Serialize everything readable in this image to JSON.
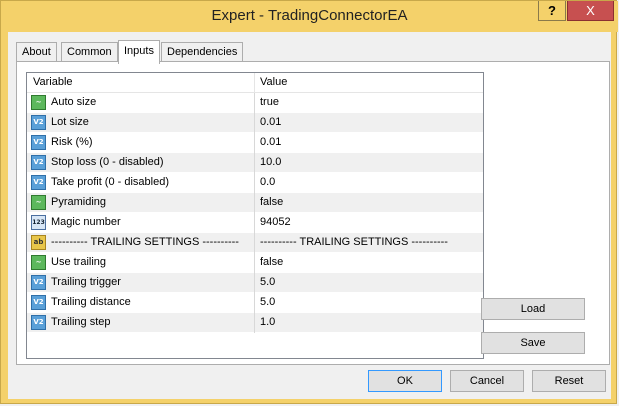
{
  "window": {
    "title": "Expert - TradingConnectorEA",
    "help_label": "?",
    "close_label": "X"
  },
  "tabs": [
    "About",
    "Common",
    "Inputs",
    "Dependencies"
  ],
  "active_tab": "Inputs",
  "grid": {
    "col_variable": "Variable",
    "col_value": "Value",
    "rows": [
      {
        "icon": "bool-icon",
        "name": "Auto size",
        "value": "true"
      },
      {
        "icon": "double-icon",
        "name": "Lot size",
        "value": "0.01"
      },
      {
        "icon": "double-icon",
        "name": "Risk (%)",
        "value": "0.01"
      },
      {
        "icon": "double-icon",
        "name": "Stop loss (0 - disabled)",
        "value": "10.0"
      },
      {
        "icon": "double-icon",
        "name": "Take profit (0 - disabled)",
        "value": "0.0"
      },
      {
        "icon": "bool-icon",
        "name": "Pyramiding",
        "value": "false"
      },
      {
        "icon": "int-icon",
        "name": "Magic number",
        "value": "94052"
      },
      {
        "icon": "string-icon",
        "name": "---------- TRAILING SETTINGS ----------",
        "value": "---------- TRAILING SETTINGS ----------"
      },
      {
        "icon": "bool-icon",
        "name": "Use trailing",
        "value": "false"
      },
      {
        "icon": "double-icon",
        "name": "Trailing trigger",
        "value": "5.0"
      },
      {
        "icon": "double-icon",
        "name": "Trailing distance",
        "value": "5.0"
      },
      {
        "icon": "double-icon",
        "name": "Trailing step",
        "value": "1.0"
      }
    ]
  },
  "icon_glyphs": {
    "bool-icon": "~",
    "double-icon": "V2",
    "int-icon": "123",
    "string-icon": "ab"
  },
  "buttons": {
    "load": "Load",
    "save": "Save",
    "ok": "OK",
    "cancel": "Cancel",
    "reset": "Reset"
  }
}
